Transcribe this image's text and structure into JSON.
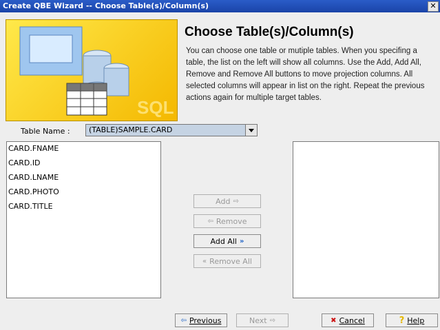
{
  "window": {
    "title": "Create QBE Wizard -- Choose Table(s)/Column(s)",
    "close_label": "✕"
  },
  "header": {
    "heading": "Choose Table(s)/Column(s)",
    "description": "You can choose one table or mutiple tables. When you specifing a table, the list on the left will show all columns. Use the Add, Add All, Remove and Remove All buttons to move projection columns. All selected columns will appear in list on the right. Repeat the previous actions again for multiple target tables."
  },
  "table_name": {
    "label": "Table Name :",
    "value": "(TABLE)SAMPLE.CARD"
  },
  "available_columns": [
    "CARD.FNAME",
    "CARD.ID",
    "CARD.LNAME",
    "CARD.PHOTO",
    "CARD.TITLE"
  ],
  "selected_columns": [],
  "transfer_buttons": {
    "add": "Add",
    "remove": "Remove",
    "add_all": "Add All",
    "remove_all": "Remove All"
  },
  "footer": {
    "previous": "Previous",
    "next": "Next",
    "cancel": "Cancel",
    "help": "Help"
  },
  "colors": {
    "titlebar": "#1a44a8",
    "banner": "#ffd21f",
    "accent_blue": "#1f63c7",
    "cancel_red": "#cc1111"
  }
}
